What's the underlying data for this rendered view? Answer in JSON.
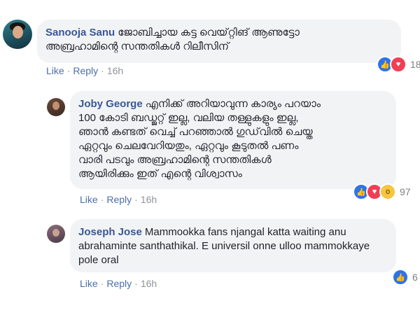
{
  "comments": [
    {
      "author": "Sanooja Sanu",
      "text": "ജോബിച്ചായ കട്ട വെയ്റ്റിങ് ആണുട്ടോ\nഅബ്രഹാമിന്റെ സന്തതികൾ റിലീസിന്",
      "actions": {
        "like": "Like",
        "reply": "Reply",
        "time": "16h"
      },
      "reactions": {
        "icons": [
          "like-icon",
          "love-icon"
        ],
        "count": "18"
      }
    },
    {
      "author": "Joby George",
      "text": "എനിക്ക് അറിയാവുന്ന കാര്യം പറയാം\n100 കോടി ബഡ്ജറ്റ് ഇല്ല, വലിയ തള്ളുകളും ഇല്ല,\nഞാൻ കണ്ടത് വെച്ച് പറഞ്ഞാൽ ഗുഡ്‌വിൽ ചെയ്ത\nഏറ്റവും ചെലവേറിയതും, ഏറ്റവും കൂടുതൽ പണം\nവാരി പടവും അബ്രഹാമിന്റെ സന്തതികൾ\nആയിരിക്കും ഇത് എന്റെ വിശ്വാസം",
      "actions": {
        "like": "Like",
        "reply": "Reply",
        "time": "16h"
      },
      "reactions": {
        "icons": [
          "like-icon",
          "love-icon",
          "wow-icon"
        ],
        "count": "97"
      }
    },
    {
      "author": "Joseph Jose",
      "text": "Mammookka fans njangal katta waiting anu\nabrahaminte santhathikal. E universil onne ulloo mammokkaye\npole oral",
      "actions": {
        "like": "Like",
        "reply": "Reply",
        "time": "16h"
      },
      "reactions": {
        "icons": [
          "like-icon"
        ],
        "count": "6"
      }
    }
  ],
  "colors": {
    "author": "#385898",
    "link": "#4b6fa8",
    "bubble": "#f2f3f5"
  }
}
